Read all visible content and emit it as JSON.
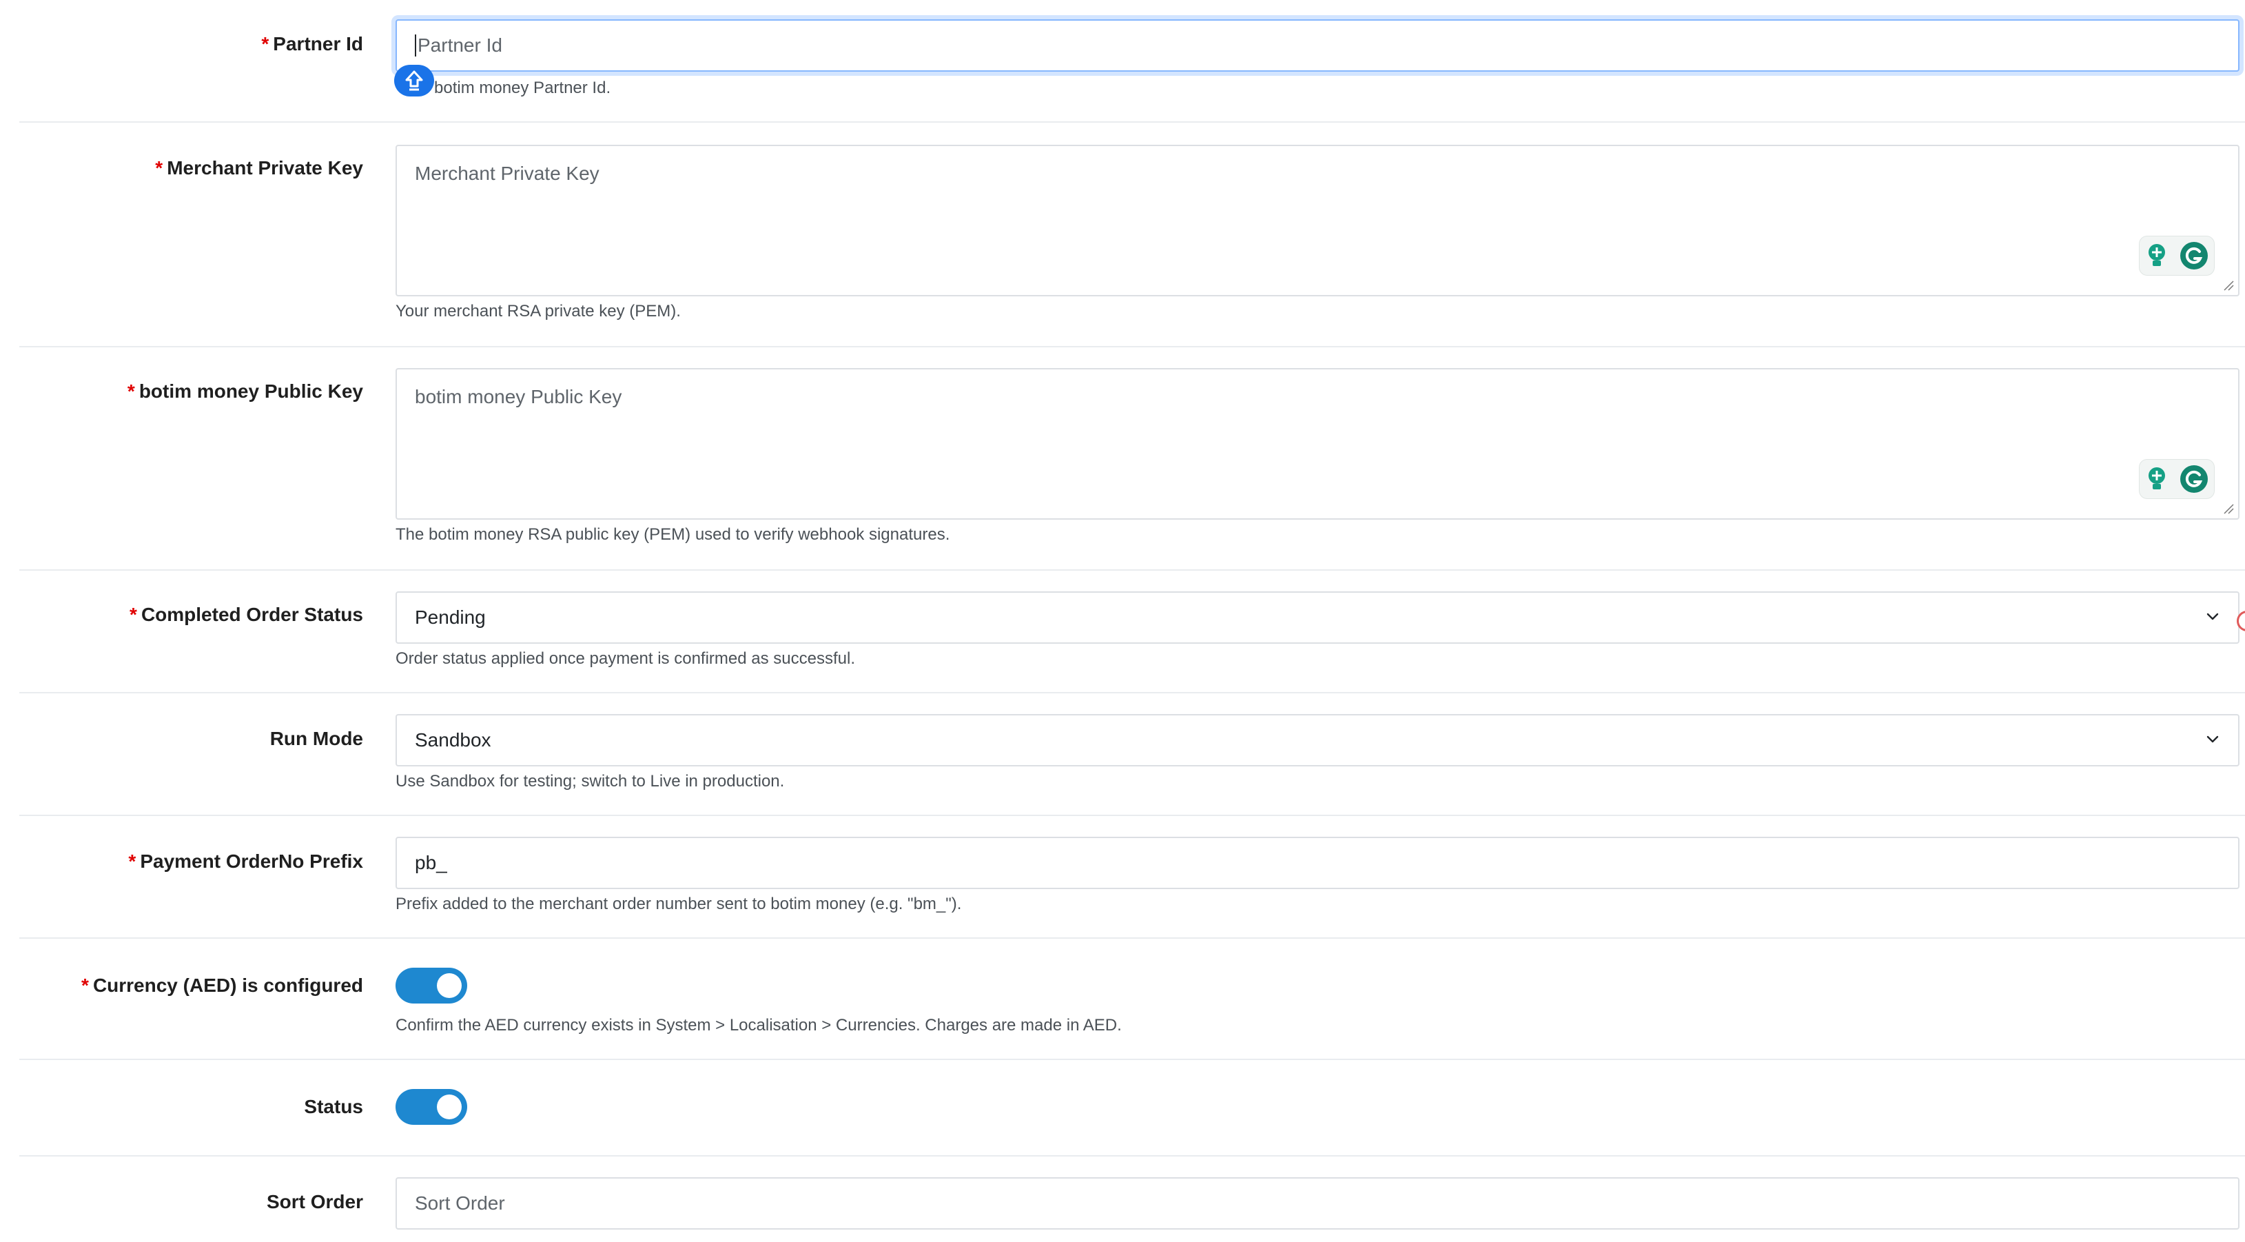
{
  "fields": {
    "partner_id": {
      "label": "Partner Id",
      "required_mark": "*",
      "placeholder": "Partner Id",
      "help": "botim money Partner Id."
    },
    "merchant_private_key": {
      "label": "Merchant Private Key",
      "required_mark": "*",
      "placeholder": "Merchant Private Key",
      "help": "Your merchant RSA private key (PEM)."
    },
    "botim_public_key": {
      "label": "botim money Public Key",
      "required_mark": "*",
      "placeholder": "botim money Public Key",
      "help": "The botim money RSA public key (PEM) used to verify webhook signatures."
    },
    "completed_order_status": {
      "label": "Completed Order Status",
      "required_mark": "*",
      "value": "Pending",
      "help": "Order status applied once payment is confirmed as successful."
    },
    "run_mode": {
      "label": "Run Mode",
      "value": "Sandbox",
      "help": "Use Sandbox for testing; switch to Live in production."
    },
    "payment_orderno_prefix": {
      "label": "Payment OrderNo Prefix",
      "required_mark": "*",
      "value": "pb_",
      "help": "Prefix added to the merchant order number sent to botim money (e.g. \"bm_\")."
    },
    "currency_configured": {
      "label": "Currency (AED) is configured",
      "required_mark": "*",
      "checked": true,
      "help": "Confirm the AED currency exists in System > Localisation > Currencies. Charges are made in AED."
    },
    "status": {
      "label": "Status",
      "checked": true
    },
    "sort_order": {
      "label": "Sort Order",
      "placeholder": "Sort Order"
    }
  },
  "icons": {
    "select_arrow": "chevron-down-icon",
    "grammarly": "grammarly-icon",
    "suggestion": "lightbulb-icon",
    "keyboard_badge": "keyboard-icon"
  },
  "colors": {
    "required": "#e00000",
    "toggle_on": "#1e88d0",
    "focus_border": "#86b7fe",
    "grammarly_green": "#15a085"
  }
}
